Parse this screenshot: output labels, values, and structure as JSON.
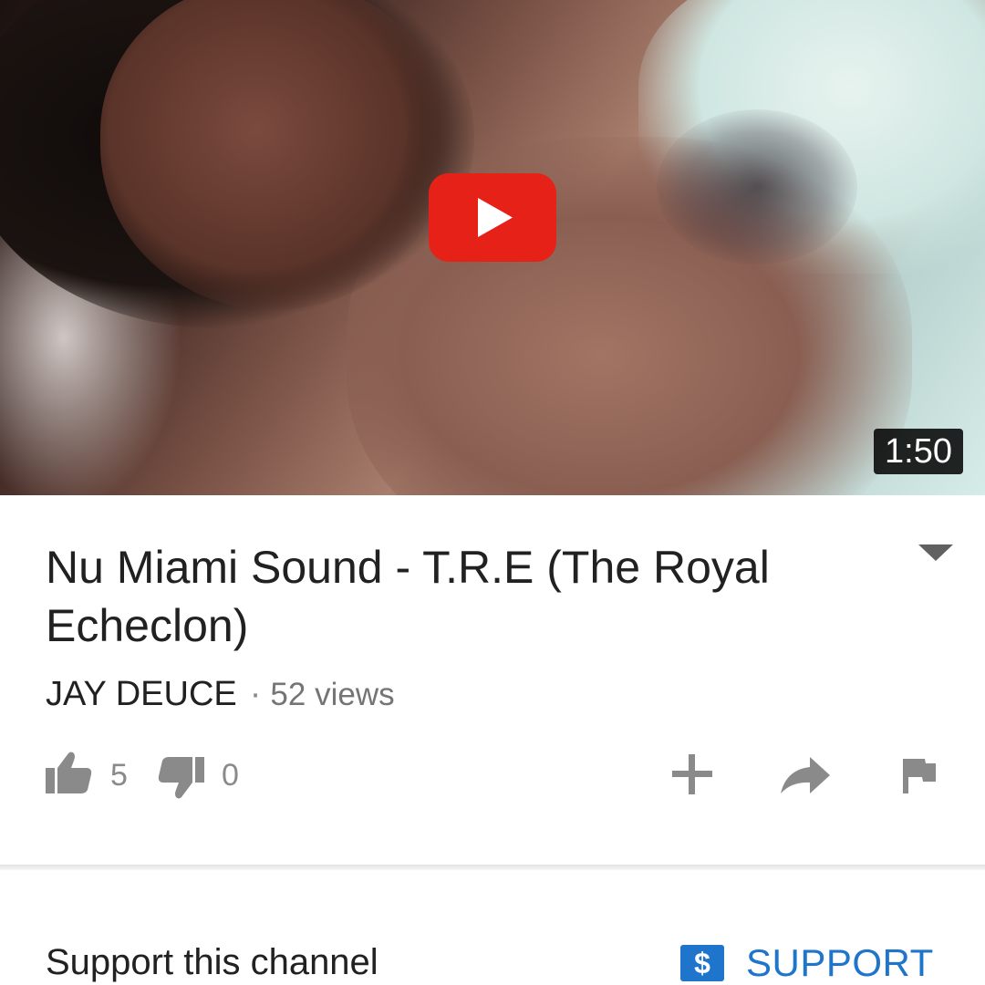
{
  "video": {
    "duration": "1:50",
    "title": "Nu Miami Sound - T.R.E (The Royal Echeclon)",
    "channel": "JAY DEUCE",
    "separator": "·",
    "views": "52 views"
  },
  "actions": {
    "likes": "5",
    "dislikes": "0"
  },
  "support": {
    "label": "Support this channel",
    "button": "SUPPORT",
    "dollar": "$"
  },
  "colors": {
    "play_red": "#e62117",
    "link_blue": "#1f75cb",
    "icon_gray": "#8a8a8a",
    "text_dark": "#212121"
  }
}
